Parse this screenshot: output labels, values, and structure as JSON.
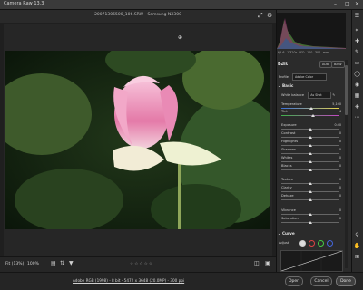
{
  "app": {
    "title": "Camera Raw 13.3"
  },
  "document": {
    "filename": "20071306500_106.SRW  -  Samsung NX300"
  },
  "histogram": {
    "camera_info": [
      "f/5.6",
      "1/320s",
      "ISO 100",
      "300 mm"
    ]
  },
  "edit": {
    "header": "Edit",
    "auto_label": "Auto",
    "bw_label": "B&W",
    "profile_label": "Profile",
    "profile_value": "Adobe Color",
    "basic_label": "Basic",
    "wb_label": "White balance",
    "wb_value": "As Shot",
    "sliders": [
      {
        "label": "Temperature",
        "value": "5,100",
        "level": 0.52,
        "temp": true
      },
      {
        "label": "Tint",
        "value": "+4",
        "level": 0.55,
        "tint": true
      },
      {
        "label": "Exposure",
        "value": "0.00",
        "level": 0.5
      },
      {
        "label": "Contrast",
        "value": "0",
        "level": 0.5
      },
      {
        "label": "Highlights",
        "value": "0",
        "level": 0.5
      },
      {
        "label": "Shadows",
        "value": "0",
        "level": 0.5
      },
      {
        "label": "Whites",
        "value": "0",
        "level": 0.5
      },
      {
        "label": "Blacks",
        "value": "0",
        "level": 0.5
      },
      {
        "label": "Texture",
        "value": "0",
        "level": 0.5
      },
      {
        "label": "Clarity",
        "value": "0",
        "level": 0.5
      },
      {
        "label": "Dehaze",
        "value": "0",
        "level": 0.5
      },
      {
        "label": "Vibrance",
        "value": "0",
        "level": 0.5
      },
      {
        "label": "Saturation",
        "value": "0",
        "level": 0.5
      }
    ],
    "curve_label": "Curve",
    "adjust_label": "Adjust"
  },
  "bottom": {
    "fit_label": "Fit (13%)",
    "zoom_label": "100%",
    "stars": "☆☆☆☆☆"
  },
  "footer": {
    "info": "Adobe RGB (1998) - 8 bit - 5472 x 3648 (20.0MP) - 300 ppi",
    "open_label": "Open",
    "cancel_label": "Cancel",
    "done_label": "Done"
  },
  "colors": {
    "accent": "#e0e0e0",
    "panel": "#2b2b2b",
    "background": "#1f1f1f"
  }
}
